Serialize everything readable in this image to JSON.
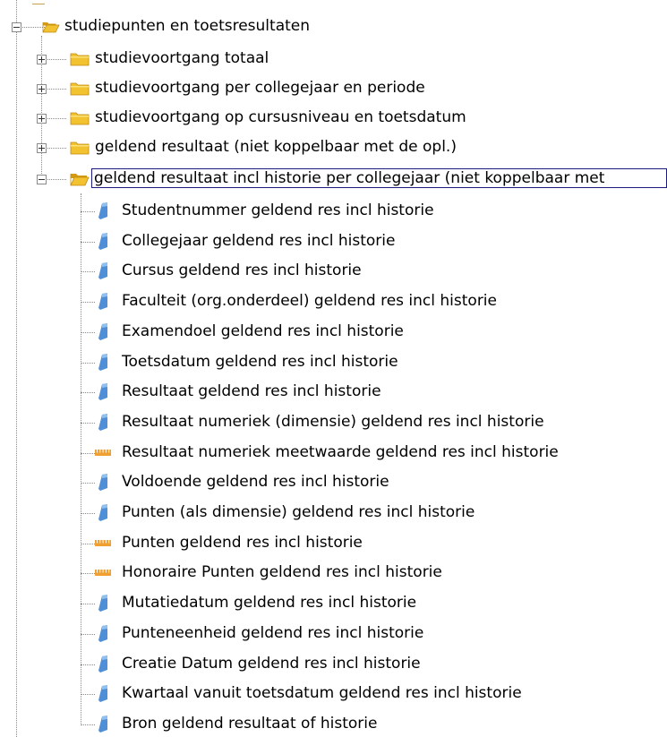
{
  "tree": {
    "root": {
      "label": "studiepunten en toetsresultaten",
      "expanded": true,
      "icon": "folder-open-icon"
    },
    "folders": [
      {
        "label": "studievoortgang totaal",
        "expanded": false,
        "icon": "folder-closed-icon"
      },
      {
        "label": "studievoortgang per collegejaar en periode",
        "expanded": false,
        "icon": "folder-closed-icon"
      },
      {
        "label": "studievoortgang op cursusniveau en toetsdatum",
        "expanded": false,
        "icon": "folder-closed-icon"
      },
      {
        "label": "geldend resultaat (niet koppelbaar met de opl.)",
        "expanded": false,
        "icon": "folder-closed-icon"
      },
      {
        "label": "geldend resultaat incl historie per collegejaar (niet koppelbaar met",
        "expanded": true,
        "selected": true,
        "icon": "folder-open-icon"
      }
    ],
    "items": [
      {
        "label": "Studentnummer geldend res incl historie",
        "type": "dimension",
        "icon": "dimension-icon"
      },
      {
        "label": "Collegejaar geldend res incl historie",
        "type": "dimension",
        "icon": "dimension-icon"
      },
      {
        "label": "Cursus geldend res incl historie",
        "type": "dimension",
        "icon": "dimension-icon"
      },
      {
        "label": "Faculteit (org.onderdeel) geldend res incl historie",
        "type": "dimension",
        "icon": "dimension-icon"
      },
      {
        "label": "Examendoel geldend res incl historie",
        "type": "dimension",
        "icon": "dimension-icon"
      },
      {
        "label": "Toetsdatum geldend res incl historie",
        "type": "dimension",
        "icon": "dimension-icon"
      },
      {
        "label": "Resultaat geldend res incl historie",
        "type": "dimension",
        "icon": "dimension-icon"
      },
      {
        "label": "Resultaat numeriek (dimensie) geldend res incl historie",
        "type": "dimension",
        "icon": "dimension-icon"
      },
      {
        "label": "Resultaat numeriek meetwaarde geldend res incl historie",
        "type": "measure",
        "icon": "measure-ruler-icon"
      },
      {
        "label": "Voldoende geldend res incl historie",
        "type": "dimension",
        "icon": "dimension-icon"
      },
      {
        "label": "Punten (als dimensie) geldend res incl historie",
        "type": "dimension",
        "icon": "dimension-icon"
      },
      {
        "label": "Punten geldend res incl historie",
        "type": "measure",
        "icon": "measure-ruler-icon"
      },
      {
        "label": "Honoraire Punten geldend res incl historie",
        "type": "measure",
        "icon": "measure-ruler-icon"
      },
      {
        "label": "Mutatiedatum geldend res incl historie",
        "type": "dimension",
        "icon": "dimension-icon"
      },
      {
        "label": "Punteneenheid geldend res incl historie",
        "type": "dimension",
        "icon": "dimension-icon"
      },
      {
        "label": "Creatie Datum geldend res incl historie",
        "type": "dimension",
        "icon": "dimension-icon"
      },
      {
        "label": "Kwartaal vanuit toetsdatum geldend res incl historie",
        "type": "dimension",
        "icon": "dimension-icon"
      },
      {
        "label": "Bron geldend resultaat of historie",
        "type": "dimension",
        "icon": "dimension-icon"
      }
    ],
    "colors": {
      "folder": "#f2c230",
      "folder_dark": "#d49a12",
      "dimension": "#4f8fd8",
      "measure": "#f0a030",
      "selection_border": "#1a1a80",
      "lines": "#8a8a8a"
    }
  }
}
